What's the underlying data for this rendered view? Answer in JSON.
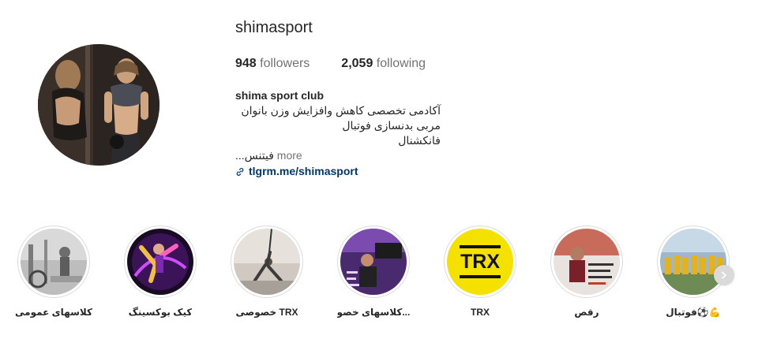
{
  "profile": {
    "username": "shimasport",
    "followers": {
      "count": "948",
      "label": "followers"
    },
    "following": {
      "count": "2,059",
      "label": "following"
    },
    "full_name": "shima sport club",
    "bio_lines": [
      "آکادمی تخصصی کاهش وافزایش وزن بانوان",
      "مربی بدنسازی فوتبال",
      "فانکشنال"
    ],
    "bio_truncated": "...فیتنس",
    "more_label": "more",
    "link": "tlgrm.me/shimasport",
    "link_color": "#00376b",
    "avatar_icon": "profile-photo"
  },
  "highlights": [
    {
      "label": "فوتبال⚽💪",
      "theme": "football-team"
    },
    {
      "label": "رقص",
      "theme": "dance-class"
    },
    {
      "label": "TRX",
      "theme": "trx-logo",
      "accent": "#f5e100"
    },
    {
      "label": "کلاسهای خصو...",
      "theme": "private-class"
    },
    {
      "label": "خصوصی TRX",
      "theme": "trx-private"
    },
    {
      "label": "کیک بوکسینگ",
      "theme": "kickboxing"
    },
    {
      "label": "کلاسهای عمومی",
      "theme": "general-class"
    }
  ],
  "trx_logo_text": "TRX",
  "next_icon": "chevron-right-icon"
}
